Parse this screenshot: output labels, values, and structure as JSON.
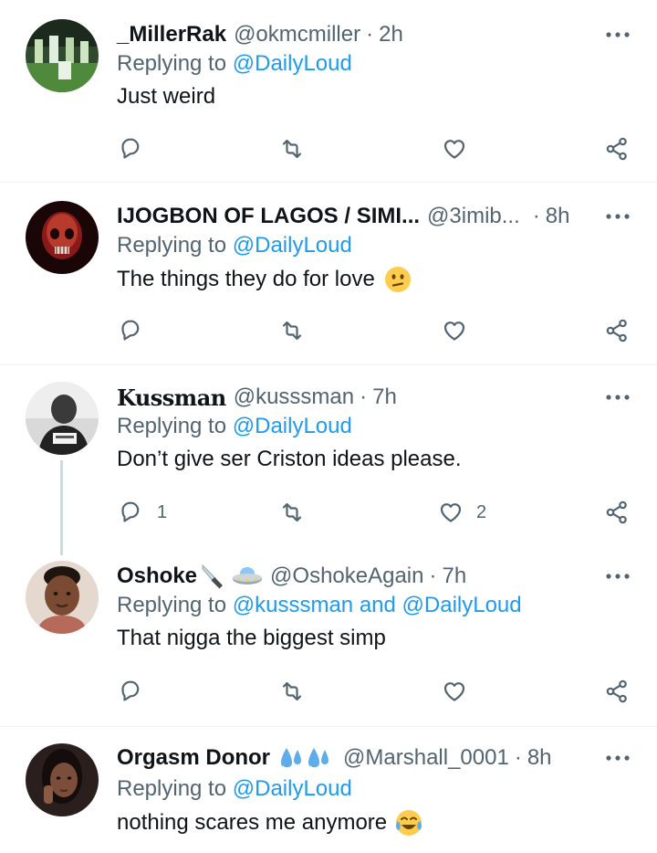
{
  "tweets": [
    {
      "name": "_MillerRak",
      "handle": "@okmcmiller",
      "dot": "·",
      "time": "2h",
      "reply_prefix": "Replying to",
      "reply_to": "@DailyLoud",
      "text": "Just weird",
      "reply_count": "",
      "like_count": ""
    },
    {
      "name": "IJOGBON OF LAGOS / SIMI...",
      "handle": "@3imib...",
      "dot": "·",
      "time": "8h",
      "reply_prefix": "Replying to",
      "reply_to": "@DailyLoud",
      "text": "The things they do for love",
      "reply_count": "",
      "like_count": ""
    },
    {
      "name": "Kussman",
      "handle": "@kusssman",
      "dot": "·",
      "time": "7h",
      "reply_prefix": "Replying to",
      "reply_to": "@DailyLoud",
      "text": "Don’t give ser Criston ideas please.",
      "reply_count": "1",
      "like_count": "2"
    },
    {
      "name": "Oshoke",
      "handle": "@OshokeAgain",
      "dot": "·",
      "time": "7h",
      "reply_prefix": "Replying to",
      "reply_to": "@kusssman and @DailyLoud",
      "text": "That nigga the biggest simp",
      "reply_count": "",
      "like_count": ""
    },
    {
      "name": "Orgasm Donor",
      "handle": "@Marshall_0001",
      "dot": "·",
      "time": "8h",
      "reply_prefix": "Replying to",
      "reply_to": "@DailyLoud",
      "text": "nothing scares me anymore",
      "reply_count": "",
      "like_count": ""
    }
  ],
  "icons": {
    "more": "more-horizontal-icon",
    "reply": "reply-bubble-icon",
    "retweet": "retweet-icon",
    "like": "heart-icon",
    "share": "share-icon"
  },
  "colors": {
    "link": "#1d9bf0",
    "secondary_text": "#536471",
    "icon": "#536471",
    "thread_line": "#cfd9de",
    "separator": "#eff3f4"
  }
}
